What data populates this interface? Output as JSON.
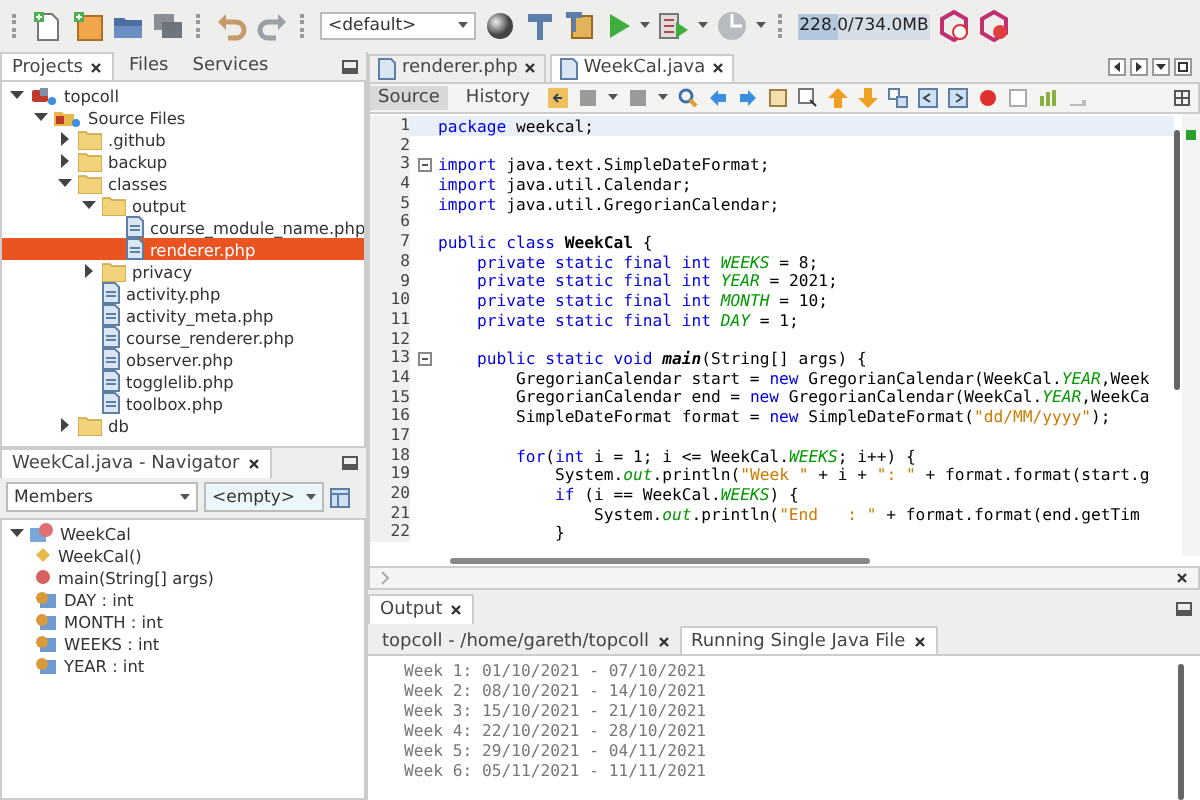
{
  "toolbar": {
    "configuration": "<default>",
    "memory": {
      "reading": "228.0/734.0MB",
      "level": 0.31
    }
  },
  "projects_panel": {
    "tabs": [
      {
        "label": "Projects",
        "selected": true
      },
      {
        "label": "Files",
        "selected": false
      },
      {
        "label": "Services",
        "selected": false
      }
    ],
    "tree": [
      {
        "label": "topcoll",
        "kind": "project",
        "expanded": true,
        "selected": false,
        "children": [
          {
            "label": "Source Files",
            "kind": "source",
            "expanded": true,
            "selected": false,
            "children": [
              {
                "label": ".github",
                "kind": "folder",
                "expanded": false,
                "selected": false
              },
              {
                "label": "backup",
                "kind": "folder",
                "expanded": false,
                "selected": false
              },
              {
                "label": "classes",
                "kind": "folder",
                "expanded": true,
                "selected": false,
                "children": [
                  {
                    "label": "output",
                    "kind": "folder",
                    "expanded": true,
                    "selected": false,
                    "children": [
                      {
                        "label": "course_module_name.php",
                        "kind": "file",
                        "selected": false
                      },
                      {
                        "label": "renderer.php",
                        "kind": "file",
                        "selected": true
                      }
                    ]
                  },
                  {
                    "label": "privacy",
                    "kind": "folder",
                    "expanded": false,
                    "selected": false
                  },
                  {
                    "label": "activity.php",
                    "kind": "file",
                    "selected": false
                  },
                  {
                    "label": "activity_meta.php",
                    "kind": "file",
                    "selected": false
                  },
                  {
                    "label": "course_renderer.php",
                    "kind": "file",
                    "selected": false
                  },
                  {
                    "label": "observer.php",
                    "kind": "file",
                    "selected": false
                  },
                  {
                    "label": "togglelib.php",
                    "kind": "file",
                    "selected": false
                  },
                  {
                    "label": "toolbox.php",
                    "kind": "file",
                    "selected": false
                  }
                ]
              },
              {
                "label": "db",
                "kind": "folder",
                "expanded": false,
                "selected": false
              }
            ]
          }
        ]
      }
    ]
  },
  "navigator": {
    "title": "WeekCal.java - Navigator",
    "view": "Members",
    "filter": "<empty>",
    "tree": [
      {
        "label": "WeekCal",
        "kind": "class",
        "expanded": true,
        "children": [
          {
            "label": "WeekCal()",
            "kind": "constructor"
          },
          {
            "label": "main(String[] args)",
            "kind": "method"
          },
          {
            "label": "DAY : int",
            "kind": "field"
          },
          {
            "label": "MONTH : int",
            "kind": "field"
          },
          {
            "label": "WEEKS : int",
            "kind": "field"
          },
          {
            "label": "YEAR : int",
            "kind": "field"
          }
        ]
      }
    ]
  },
  "editor": {
    "tabs": [
      {
        "label": "renderer.php",
        "selected": false
      },
      {
        "label": "WeekCal.java",
        "selected": true
      }
    ],
    "views": [
      {
        "label": "Source",
        "selected": true
      },
      {
        "label": "History",
        "selected": false
      }
    ],
    "lines": [
      {
        "number": "1",
        "highlighted": true,
        "foldable": false,
        "tokens": [
          {
            "kind": "keyword",
            "text": "package"
          },
          {
            "kind": "plain",
            "text": " weekcal;"
          }
        ]
      },
      {
        "number": "2",
        "highlighted": false,
        "foldable": false
      },
      {
        "number": "3",
        "highlighted": false,
        "foldable": true,
        "tokens": [
          {
            "kind": "keyword",
            "text": "import"
          },
          {
            "kind": "plain",
            "text": " java.text.SimpleDateFormat;"
          }
        ]
      },
      {
        "number": "4",
        "highlighted": false,
        "foldable": false,
        "tokens": [
          {
            "kind": "keyword",
            "text": "import"
          },
          {
            "kind": "plain",
            "text": " java.util.Calendar;"
          }
        ]
      },
      {
        "number": "5",
        "highlighted": false,
        "foldable": false,
        "tokens": [
          {
            "kind": "keyword",
            "text": "import"
          },
          {
            "kind": "plain",
            "text": " java.util.GregorianCalendar;"
          }
        ]
      },
      {
        "number": "6",
        "highlighted": false,
        "foldable": false
      },
      {
        "number": "7",
        "highlighted": false,
        "foldable": false,
        "tokens": [
          {
            "kind": "keyword",
            "text": "public class "
          },
          {
            "kind": "bold",
            "text": "WeekCal"
          },
          {
            "kind": "plain",
            "text": " {"
          }
        ]
      },
      {
        "number": "8",
        "highlighted": false,
        "foldable": false,
        "tokens": [
          {
            "kind": "keyword",
            "text": "    private static final int "
          },
          {
            "kind": "field",
            "text": "WEEKS"
          },
          {
            "kind": "plain",
            "text": " = 8;"
          }
        ]
      },
      {
        "number": "9",
        "highlighted": false,
        "foldable": false,
        "tokens": [
          {
            "kind": "keyword",
            "text": "    private static final int "
          },
          {
            "kind": "field",
            "text": "YEAR"
          },
          {
            "kind": "plain",
            "text": " = 2021;"
          }
        ]
      },
      {
        "number": "10",
        "highlighted": false,
        "foldable": false,
        "tokens": [
          {
            "kind": "keyword",
            "text": "    private static final int "
          },
          {
            "kind": "field",
            "text": "MONTH"
          },
          {
            "kind": "plain",
            "text": " = 10;"
          }
        ]
      },
      {
        "number": "11",
        "highlighted": false,
        "foldable": false,
        "tokens": [
          {
            "kind": "keyword",
            "text": "    private static final int "
          },
          {
            "kind": "field",
            "text": "DAY"
          },
          {
            "kind": "plain",
            "text": " = 1;"
          }
        ]
      },
      {
        "number": "12",
        "highlighted": false,
        "foldable": false
      },
      {
        "number": "13",
        "highlighted": false,
        "foldable": true,
        "tokens": [
          {
            "kind": "keyword",
            "text": "    public static void "
          },
          {
            "kind": "method",
            "text": "main"
          },
          {
            "kind": "plain",
            "text": "(String[] args) {"
          }
        ]
      },
      {
        "number": "14",
        "highlighted": false,
        "foldable": false,
        "tokens": [
          {
            "kind": "plain",
            "text": "        GregorianCalendar start = "
          },
          {
            "kind": "keyword",
            "text": "new"
          },
          {
            "kind": "plain",
            "text": " GregorianCalendar(WeekCal."
          },
          {
            "kind": "field",
            "text": "YEAR"
          },
          {
            "kind": "plain",
            "text": ",Week"
          }
        ]
      },
      {
        "number": "15",
        "highlighted": false,
        "foldable": false,
        "tokens": [
          {
            "kind": "plain",
            "text": "        GregorianCalendar end = "
          },
          {
            "kind": "keyword",
            "text": "new"
          },
          {
            "kind": "plain",
            "text": " GregorianCalendar(WeekCal."
          },
          {
            "kind": "field",
            "text": "YEAR"
          },
          {
            "kind": "plain",
            "text": ",WeekCa"
          }
        ]
      },
      {
        "number": "16",
        "highlighted": false,
        "foldable": false,
        "tokens": [
          {
            "kind": "plain",
            "text": "        SimpleDateFormat format = "
          },
          {
            "kind": "keyword",
            "text": "new"
          },
          {
            "kind": "plain",
            "text": " SimpleDateFormat("
          },
          {
            "kind": "string",
            "text": "\"dd/MM/yyyy\""
          },
          {
            "kind": "plain",
            "text": ");"
          }
        ]
      },
      {
        "number": "17",
        "highlighted": false,
        "foldable": false
      },
      {
        "number": "18",
        "highlighted": false,
        "foldable": false,
        "tokens": [
          {
            "kind": "keyword",
            "text": "        for"
          },
          {
            "kind": "plain",
            "text": "("
          },
          {
            "kind": "keyword",
            "text": "int"
          },
          {
            "kind": "plain",
            "text": " i = 1; i <= WeekCal."
          },
          {
            "kind": "field",
            "text": "WEEKS"
          },
          {
            "kind": "plain",
            "text": "; i++) {"
          }
        ]
      },
      {
        "number": "19",
        "highlighted": false,
        "foldable": false,
        "tokens": [
          {
            "kind": "plain",
            "text": "            System."
          },
          {
            "kind": "field",
            "text": "out"
          },
          {
            "kind": "plain",
            "text": ".println("
          },
          {
            "kind": "string",
            "text": "\"Week \""
          },
          {
            "kind": "plain",
            "text": " + i + "
          },
          {
            "kind": "string",
            "text": "\": \""
          },
          {
            "kind": "plain",
            "text": " + format.format(start.g"
          }
        ]
      },
      {
        "number": "20",
        "highlighted": false,
        "foldable": false,
        "tokens": [
          {
            "kind": "keyword",
            "text": "            if"
          },
          {
            "kind": "plain",
            "text": " (i == WeekCal."
          },
          {
            "kind": "field",
            "text": "WEEKS"
          },
          {
            "kind": "plain",
            "text": ") {"
          }
        ]
      },
      {
        "number": "21",
        "highlighted": false,
        "foldable": false,
        "tokens": [
          {
            "kind": "plain",
            "text": "                System."
          },
          {
            "kind": "field",
            "text": "out"
          },
          {
            "kind": "plain",
            "text": ".println("
          },
          {
            "kind": "string",
            "text": "\"End   : \""
          },
          {
            "kind": "plain",
            "text": " + format.format(end.getTim"
          }
        ]
      },
      {
        "number": "22",
        "highlighted": false,
        "foldable": false,
        "tokens": [
          {
            "kind": "plain",
            "text": "            }"
          }
        ]
      }
    ]
  },
  "output": {
    "title": "Output",
    "tabs": [
      {
        "label": "topcoll - /home/gareth/topcoll",
        "selected": false
      },
      {
        "label": "Running Single Java File",
        "selected": true
      }
    ],
    "lines": [
      "Week 1: 01/10/2021 - 07/10/2021",
      "Week 2: 08/10/2021 - 14/10/2021",
      "Week 3: 15/10/2021 - 21/10/2021",
      "Week 4: 22/10/2021 - 28/10/2021",
      "Week 5: 29/10/2021 - 04/11/2021",
      "Week 6: 05/11/2021 - 11/11/2021"
    ]
  }
}
